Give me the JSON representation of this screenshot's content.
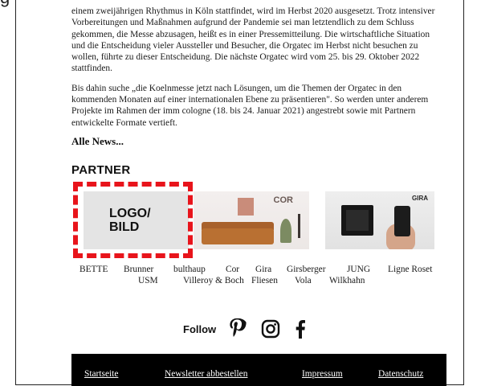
{
  "colors": {
    "accent_red": "#e8141b",
    "footer_background": "#000000",
    "text": "#1a1a1a"
  },
  "article": {
    "paragraphs": [
      "einem zweijährigen Rhythmus in Köln stattfindet, wird im Herbst 2020 ausgesetzt. Trotz intensiver Vorbereitungen und Maßnahmen aufgrund der Pandemie sei man letztendlich zu dem Schluss gekommen, die Messe abzusagen, heißt es in einer Pressemitteilung. Die wirtschaftliche Situation und die Entscheidung vieler Aussteller und Besucher, die Orgatec im Herbst nicht besuchen zu wollen, führte zu dieser Entscheidung. Die nächste Orgatec wird vom 25. bis 29. Oktober 2022 stattfinden.",
      "Bis dahin suche „die Koelnmesse jetzt nach Lösungen, um die Themen der Orgatec in den kommenden Monaten auf einer internationalen Ebene zu präsentieren\". So werden unter anderem Projekte im Rahmen der imm cologne (18. bis 24. Januar 2021) angestrebt sowie mit Partnern entwickelte Formate vertieft."
    ],
    "all_news_link": "Alle News..."
  },
  "partner": {
    "heading": "PARTNER",
    "placeholder_logo": "LOGO/\nBILD",
    "images": [
      {
        "brand": "COR",
        "icon": "cor-interior-image"
      },
      {
        "brand": "GIRA",
        "icon": "gira-product-image"
      }
    ],
    "names_row1": [
      "BETTE",
      "Brunner",
      "bulthaup",
      "Cor",
      "Gira",
      "Girsberger",
      "JUNG",
      "Ligne Roset"
    ],
    "names_row2": [
      "USM",
      "Villeroy & Boch",
      "Fliesen",
      "Vola",
      "Wilkhahn"
    ]
  },
  "follow": {
    "label": "Follow",
    "icons": [
      "pinterest-icon",
      "instagram-icon",
      "facebook-icon"
    ]
  },
  "footer": {
    "links": [
      "Startseite",
      "Newsletter abbestellen",
      "Impressum",
      "Datenschutz"
    ]
  }
}
